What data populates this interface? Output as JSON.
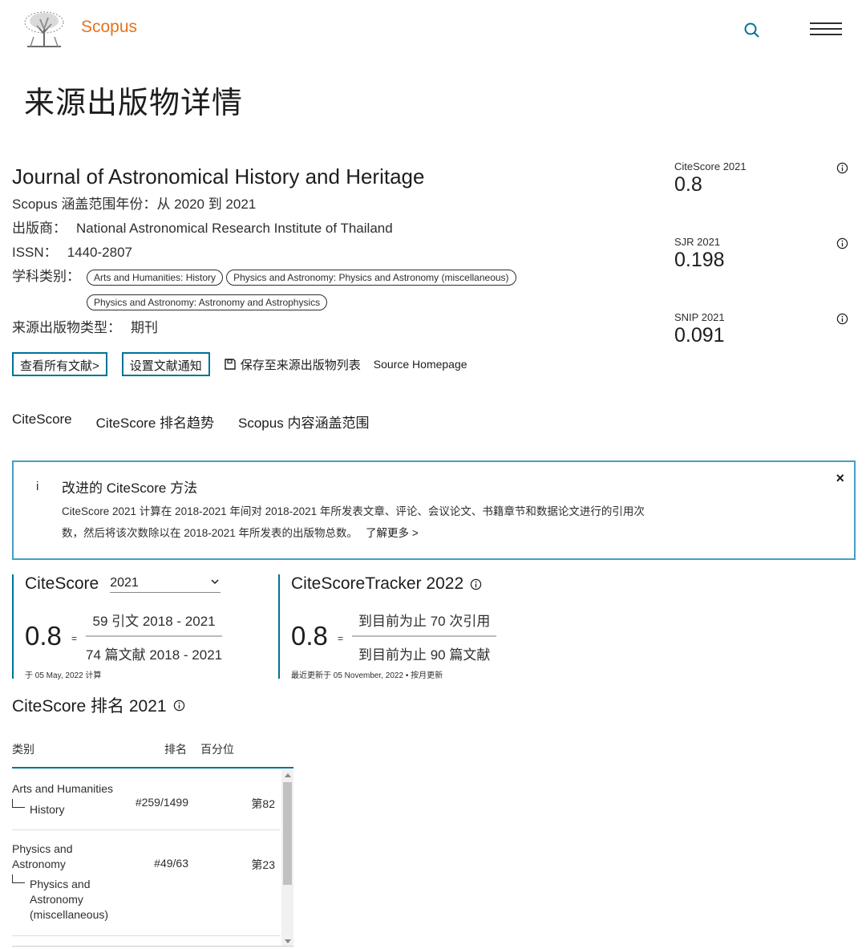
{
  "header": {
    "brand": "Scopus",
    "icons": {
      "logo": "elsevier-tree-logo",
      "search": "search-icon",
      "menu": "hamburger-menu-icon"
    },
    "colors": {
      "brand": "#e9711c",
      "accent": "#007398"
    }
  },
  "page_title": "来源出版物详情",
  "source": {
    "title": "Journal of Astronomical History and Heritage",
    "coverage_label": "Scopus 涵盖范围年份：",
    "coverage_value": "从 2020 到 2021",
    "publisher_label": "出版商：",
    "publisher_value": "National Astronomical Research Institute of Thailand",
    "issn_label": "ISSN：",
    "issn_value": "1440-2807",
    "subject_label": "学科类别：",
    "subjects": [
      "Arts and Humanities: History",
      "Physics and Astronomy: Physics and Astronomy (miscellaneous)",
      "Physics and Astronomy: Astronomy and Astrophysics"
    ],
    "type_label": "来源出版物类型：",
    "type_value": "期刊"
  },
  "actions": {
    "view_all": "查看所有文献>",
    "set_alert": "设置文献通知",
    "save_list": "保存至来源出版物列表",
    "homepage": "Source Homepage"
  },
  "metrics": [
    {
      "label": "CiteScore 2021",
      "value": "0.8"
    },
    {
      "label": "SJR 2021",
      "value": "0.198"
    },
    {
      "label": "SNIP 2021",
      "value": "0.091"
    }
  ],
  "tabs": [
    "CiteScore",
    "CiteScore 排名趋势",
    "Scopus 内容涵盖范围"
  ],
  "notice": {
    "icon_char": "i",
    "title": "改进的 CiteScore 方法",
    "body": "CiteScore 2021 计算在 2018-2021 年间对 2018-2021 年所发表文章、评论、会议论文、书籍章节和数据论文进行的引用次数，然后将该次数除以在 2018-2021 年所发表的出版物总数。",
    "learn_more": "了解更多 >",
    "close": "×"
  },
  "citescore": {
    "title": "CiteScore",
    "year": "2021",
    "value": "0.8",
    "eq": "=",
    "numerator": "59 引文 2018 - 2021",
    "denominator": "74 篇文献 2018 - 2021",
    "note": "于 05 May, 2022 计算"
  },
  "tracker": {
    "title": "CiteScoreTracker 2022",
    "value": "0.8",
    "eq": "=",
    "numerator": "到目前为止 70 次引用",
    "denominator": "到目前为止 90 篇文献",
    "note": "最近更新于 05 November, 2022 • 按月更新"
  },
  "ranking": {
    "title": "CiteScore 排名 2021",
    "headers": {
      "category": "类别",
      "rank": "排名",
      "percentile": "百分位"
    },
    "rows": [
      {
        "category": "Arts and Humanities",
        "subcategory": "History",
        "rank": "#259/1499",
        "percentile": "第82"
      },
      {
        "category": "Physics and Astronomy",
        "subcategory": "Physics and Astronomy (miscellaneous)",
        "rank": "#49/63",
        "percentile": "第23"
      }
    ]
  }
}
